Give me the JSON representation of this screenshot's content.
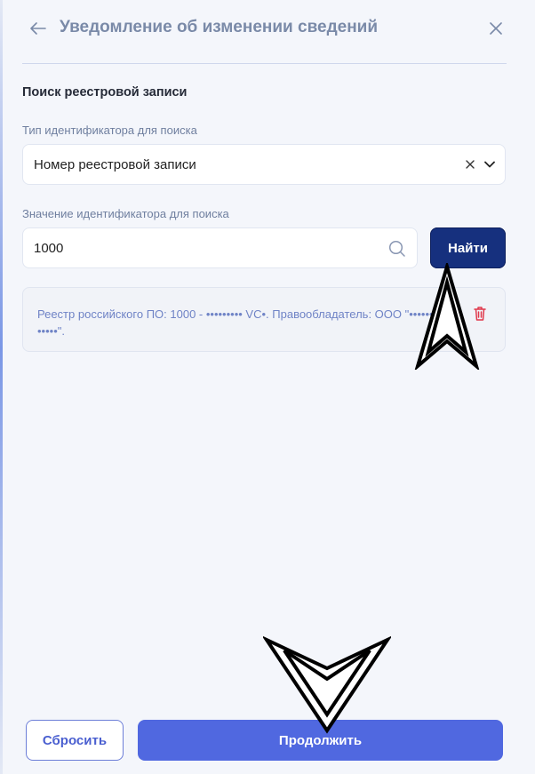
{
  "header": {
    "title": "Уведомление об изменении сведений",
    "back_icon": "arrow-left-icon",
    "close_icon": "close-icon"
  },
  "search": {
    "section_title": "Поиск реестровой записи",
    "type_label": "Тип идентификатора для поиска",
    "type_value": "Номер реестровой записи",
    "value_label": "Значение идентификатора для поиска",
    "value": "1000",
    "find_label": "Найти"
  },
  "result": {
    "text": "Реестр российского ПО: 1000 - ••••••••• VC•. Правообладатель: ООО \"•••••• •••••\"."
  },
  "footer": {
    "reset_label": "Сбросить",
    "continue_label": "Продолжить"
  },
  "colors": {
    "primary": "#5068e0",
    "primary_dark": "#16307e",
    "danger": "#e0384b",
    "muted_title": "#7a8aa8"
  }
}
